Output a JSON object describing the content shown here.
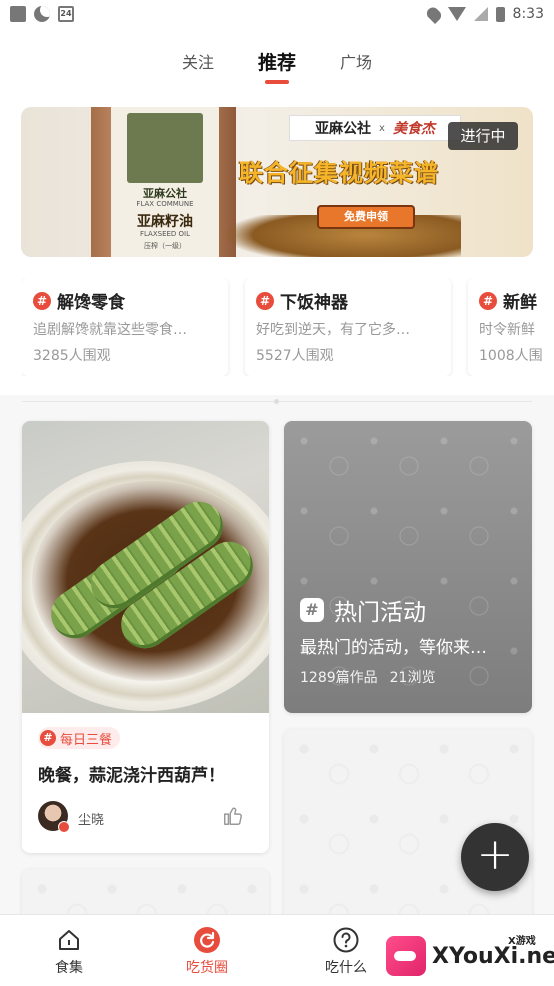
{
  "status_bar": {
    "time": "8:33",
    "calendar_day": "24"
  },
  "top_tabs": [
    "关注",
    "推荐",
    "广场"
  ],
  "top_tabs_active": "推荐",
  "banner": {
    "bottle_brand": "亚麻公社",
    "bottle_brand_en": "FLAX COMMUNE",
    "bottle_product": "亚麻籽油",
    "bottle_product_en": "FLAXSEED OIL",
    "bottle_grade": "压榨（一级）",
    "partner_1": "亚麻公社",
    "partner_x": "x",
    "partner_2": "美食杰",
    "headline": "联合征集视频菜谱",
    "cta": "免费申领",
    "status": "进行中"
  },
  "topics": [
    {
      "title": "解馋零食",
      "desc": "追剧解馋就靠这些零食…",
      "count": "3285人围观"
    },
    {
      "title": "下饭神器",
      "desc": "好吃到逆天，有了它多…",
      "count": "5527人围观"
    },
    {
      "title": "新鲜",
      "desc": "时令新鲜",
      "count": "1008人围"
    }
  ],
  "feed_post": {
    "tag": "每日三餐",
    "title": "晚餐，蒜泥浇汁西葫芦！",
    "author": "尘晓"
  },
  "activity_card": {
    "title": "热门活动",
    "desc": "最热门的活动，等你来…",
    "works": "1289篇作品",
    "views": "21浏览"
  },
  "fab": {
    "label": "+"
  },
  "bottom_nav": [
    {
      "label": "食集",
      "icon": "home-icon"
    },
    {
      "label": "吃货圈",
      "icon": "refresh-circle-icon"
    },
    {
      "label": "吃什么",
      "icon": "question-circle-icon"
    }
  ],
  "watermark": {
    "text": "XYouXi.net",
    "small": "X游戏"
  },
  "colors": {
    "accent": "#e74c3c",
    "fab": "#333333"
  }
}
